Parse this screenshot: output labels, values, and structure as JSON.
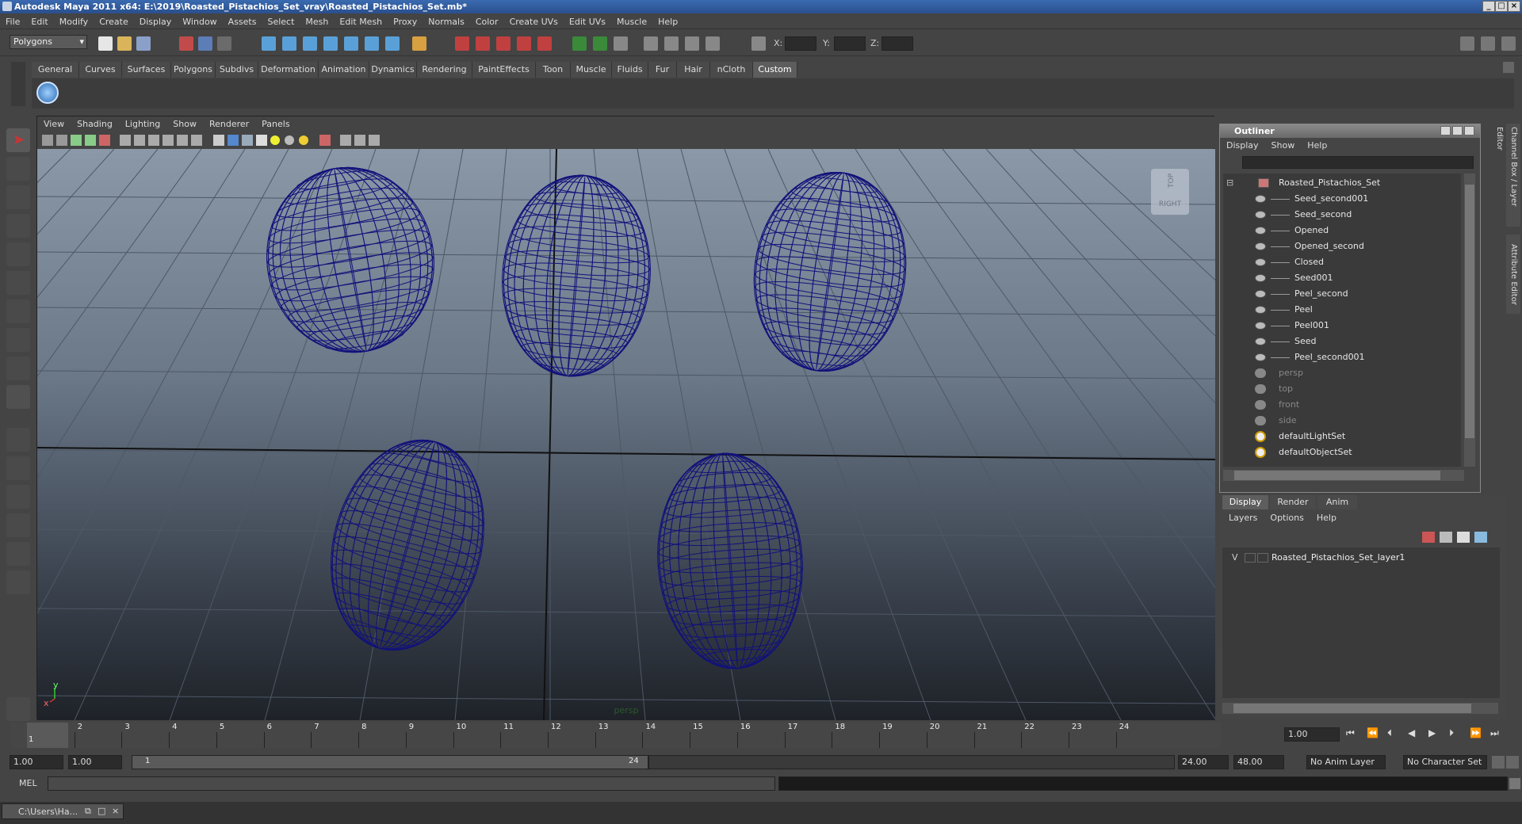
{
  "window": {
    "title": "Autodesk Maya 2011 x64: E:\\2019\\Roasted_Pistachios_Set_vray\\Roasted_Pistachios_Set.mb*",
    "min_label": "_",
    "max_label": "□",
    "close_label": "×"
  },
  "menubar": [
    "File",
    "Edit",
    "Modify",
    "Create",
    "Display",
    "Window",
    "Assets",
    "Select",
    "Mesh",
    "Edit Mesh",
    "Proxy",
    "Normals",
    "Color",
    "Create UVs",
    "Edit UVs",
    "Muscle",
    "Help"
  ],
  "status": {
    "mode": "Polygons",
    "x_label": "X:",
    "y_label": "Y:",
    "z_label": "Z:"
  },
  "shelf_tabs": [
    "General",
    "Curves",
    "Surfaces",
    "Polygons",
    "Subdivs",
    "Deformation",
    "Animation",
    "Dynamics",
    "Rendering",
    "PaintEffects",
    "Toon",
    "Muscle",
    "Fluids",
    "Fur",
    "Hair",
    "nCloth",
    "Custom"
  ],
  "shelf_active": "Custom",
  "viewport": {
    "menu": [
      "View",
      "Shading",
      "Lighting",
      "Show",
      "Renderer",
      "Panels"
    ],
    "camera_label": "persp",
    "viewcube_top": "TOP",
    "viewcube_right": "RIGHT",
    "axis_y": "y",
    "axis_x": "x",
    "wire_color": "#12127a"
  },
  "outliner": {
    "title": "Outliner",
    "menu": [
      "Display",
      "Show",
      "Help"
    ],
    "root": "Roasted_Pistachios_Set",
    "children": [
      "Seed_second001",
      "Seed_second",
      "Opened",
      "Opened_second",
      "Closed",
      "Seed001",
      "Peel_second",
      "Peel",
      "Peel001",
      "Seed",
      "Peel_second001"
    ],
    "cameras": [
      "persp",
      "top",
      "front",
      "side"
    ],
    "sets": [
      "defaultLightSet",
      "defaultObjectSet"
    ]
  },
  "layers": {
    "tabs": [
      "Display",
      "Render",
      "Anim"
    ],
    "active_tab": "Display",
    "menu": [
      "Layers",
      "Options",
      "Help"
    ],
    "visibility": "V",
    "layer_name": "Roasted_Pistachios_Set_layer1"
  },
  "side_tabs": {
    "channel_box": "Channel Box / Layer Editor",
    "attribute_editor": "Attribute Editor"
  },
  "timeline": {
    "ticks": [
      "1",
      "2",
      "3",
      "4",
      "5",
      "6",
      "7",
      "8",
      "9",
      "10",
      "11",
      "12",
      "13",
      "14",
      "15",
      "16",
      "17",
      "18",
      "19",
      "20",
      "21",
      "22",
      "23",
      "24"
    ],
    "current_frame": "1.00",
    "current_marker": "1"
  },
  "range": {
    "start": "1.00",
    "start2": "1.00",
    "slider_start": "1",
    "slider_end": "24",
    "end": "24.00",
    "end2": "48.00",
    "anim_layer": "No Anim Layer",
    "character_set": "No Character Set"
  },
  "command": {
    "mel_label": "MEL"
  },
  "taskbar": {
    "item": "C:\\Users\\Ha..."
  }
}
